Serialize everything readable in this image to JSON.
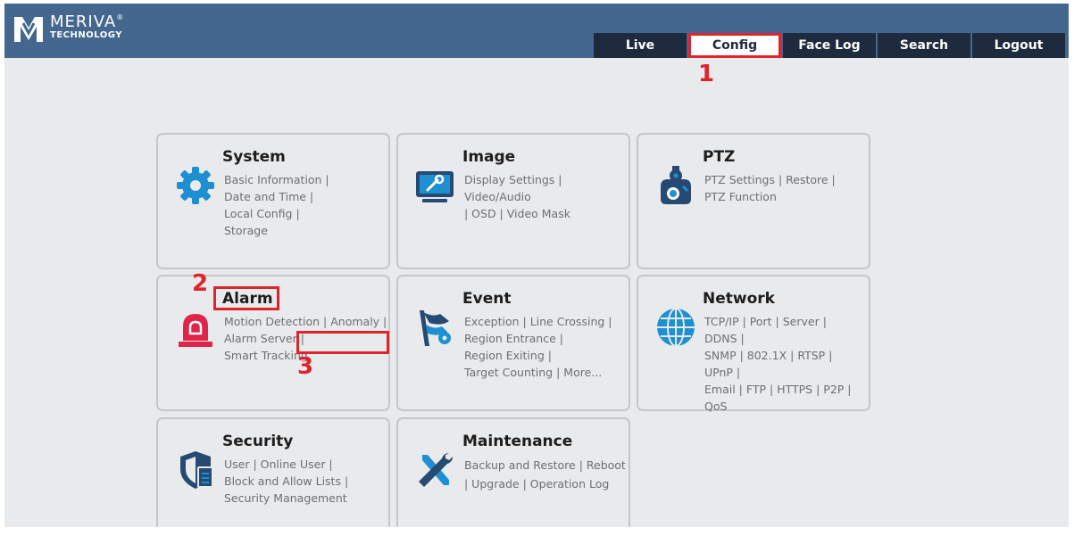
{
  "brand": {
    "name": "MERIVA",
    "reg": "®",
    "sub": "TECHNOLOGY"
  },
  "nav": [
    {
      "label": "Live"
    },
    {
      "label": "Config",
      "active": true
    },
    {
      "label": "Face Log"
    },
    {
      "label": "Search"
    },
    {
      "label": "Logout"
    }
  ],
  "cards": {
    "system": {
      "title": "System",
      "links": [
        "Basic Information |",
        "Date and Time |",
        "Local Config |",
        "Storage"
      ],
      "icon": "gear-icon"
    },
    "image": {
      "title": "Image",
      "links": [
        "Display Settings |",
        "Video/Audio",
        "| OSD |",
        "Video Mask"
      ],
      "icon": "monitor-icon"
    },
    "ptz": {
      "title": "PTZ",
      "links": [
        "PTZ Settings |",
        "Restore |",
        "PTZ Function"
      ],
      "icon": "ptz-camera-icon"
    },
    "alarm": {
      "title": "Alarm",
      "links": [
        "Motion Detection |",
        "Anomaly |",
        "Alarm Server |",
        "Smart Tracking"
      ],
      "icon": "siren-icon"
    },
    "event": {
      "title": "Event",
      "links": [
        "Exception |",
        "Line Crossing |",
        "Region Entrance |",
        "Region Exiting |",
        "Target Counting |",
        "More..."
      ],
      "icon": "event-flag-icon"
    },
    "network": {
      "title": "Network",
      "links": [
        "TCP/IP |",
        "Port |",
        "Server |",
        "DDNS |",
        "SNMP |",
        "802.1X |",
        "RTSP |",
        "UPnP |",
        "Email |",
        "FTP |",
        "HTTPS |",
        "P2P |",
        "QoS"
      ],
      "icon": "globe-icon"
    },
    "security": {
      "title": "Security",
      "links": [
        "User |",
        "Online User |",
        "Block and Allow Lists |",
        "Security Management"
      ],
      "icon": "shield-document-icon"
    },
    "maintenance": {
      "title": "Maintenance",
      "links": [
        "Backup and Restore",
        "| Reboot",
        "| Upgrade |",
        "Operation Log"
      ],
      "icon": "tools-icon"
    }
  },
  "annotations": [
    "1",
    "2",
    "3"
  ],
  "colors": {
    "header": "#44678f",
    "nav_tab": "#1e2a3d",
    "highlight": "#e0242b",
    "icon_blue": "#1e8fd0",
    "icon_red": "#e0244a",
    "icon_navy": "#264a73"
  }
}
